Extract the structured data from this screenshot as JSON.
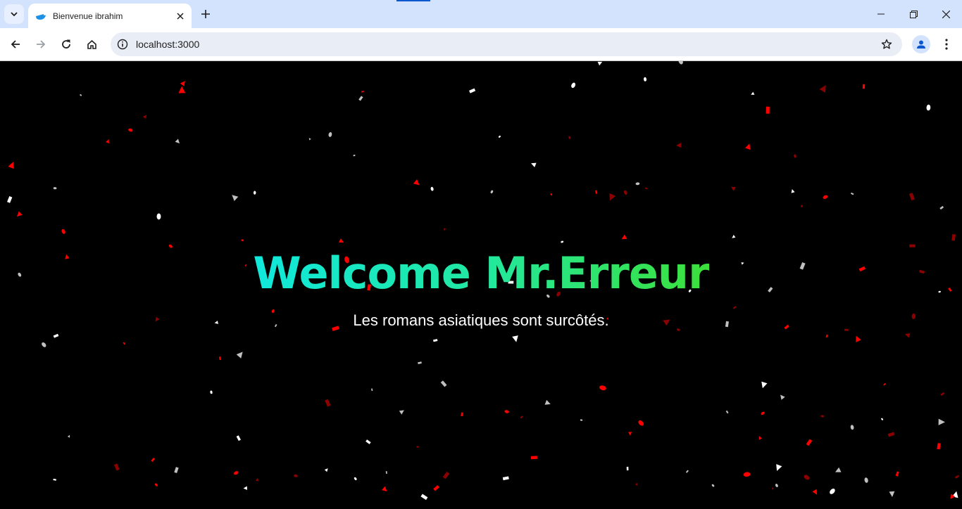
{
  "browser": {
    "tab": {
      "title": "Bienvenue ibrahim"
    },
    "address_bar": {
      "url": "localhost:3000"
    }
  },
  "page": {
    "heading": "Welcome Mr.Erreur",
    "subtitle": "Les romans asiatiques sont surcôtés."
  },
  "colors": {
    "background": "#000000",
    "heading_gradient": [
      "#10e8dc",
      "#3ce03a"
    ],
    "confetti": [
      "#ff0000",
      "#8b0000",
      "#ffffff",
      "#c0c0c0"
    ]
  }
}
